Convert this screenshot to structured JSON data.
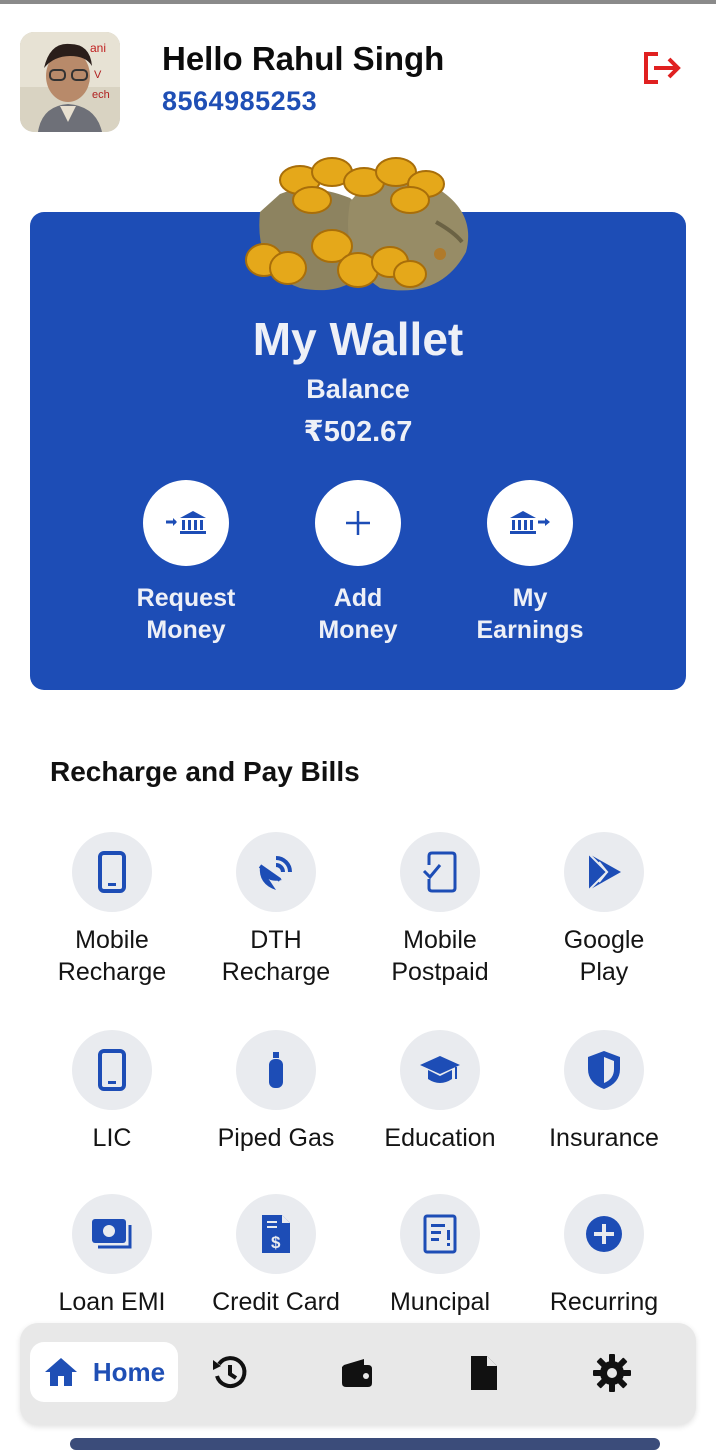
{
  "header": {
    "greeting": "Hello Rahul Singh",
    "phone": "8564985253",
    "logout_icon": "logout-icon"
  },
  "wallet": {
    "title": "My Wallet",
    "balance_label": "Balance",
    "balance_value": "₹502.67",
    "actions": [
      {
        "label_line1": "Request",
        "label_line2": "Money",
        "icon": "bank-in-icon"
      },
      {
        "label_line1": "Add",
        "label_line2": "Money",
        "icon": "plus-icon"
      },
      {
        "label_line1": "My",
        "label_line2": "Earnings",
        "icon": "bank-out-icon"
      }
    ]
  },
  "services": {
    "title": "Recharge and Pay Bills",
    "items": [
      {
        "line1": "Mobile",
        "line2": "Recharge",
        "icon": "mobile-icon"
      },
      {
        "line1": "DTH",
        "line2": "Recharge",
        "icon": "satellite-dish-icon"
      },
      {
        "line1": "Mobile",
        "line2": "Postpaid",
        "icon": "mobile-check-icon"
      },
      {
        "line1": "Google",
        "line2": "Play",
        "icon": "google-play-icon"
      },
      {
        "line1": "LIC",
        "line2": "",
        "icon": "mobile-icon"
      },
      {
        "line1": "Piped Gas",
        "line2": "",
        "icon": "gas-bottle-icon"
      },
      {
        "line1": "Education",
        "line2": "",
        "icon": "graduation-cap-icon"
      },
      {
        "line1": "Insurance",
        "line2": "",
        "icon": "shield-icon"
      },
      {
        "line1": "Loan EMI",
        "line2": "",
        "icon": "cash-icon"
      },
      {
        "line1": "Credit Card",
        "line2": "",
        "icon": "invoice-dollar-icon"
      },
      {
        "line1": "Muncipal",
        "line2": "",
        "icon": "receipt-icon"
      },
      {
        "line1": "Recurring",
        "line2": "",
        "icon": "plus-circle-icon"
      }
    ]
  },
  "nav": {
    "home_label": "Home",
    "items": [
      "home-icon",
      "history-icon",
      "wallet-icon",
      "document-icon",
      "gear-icon"
    ]
  },
  "colors": {
    "brand_blue": "#1d4db6",
    "accent_text": "#1f4fb5",
    "logout_red": "#e02020"
  }
}
